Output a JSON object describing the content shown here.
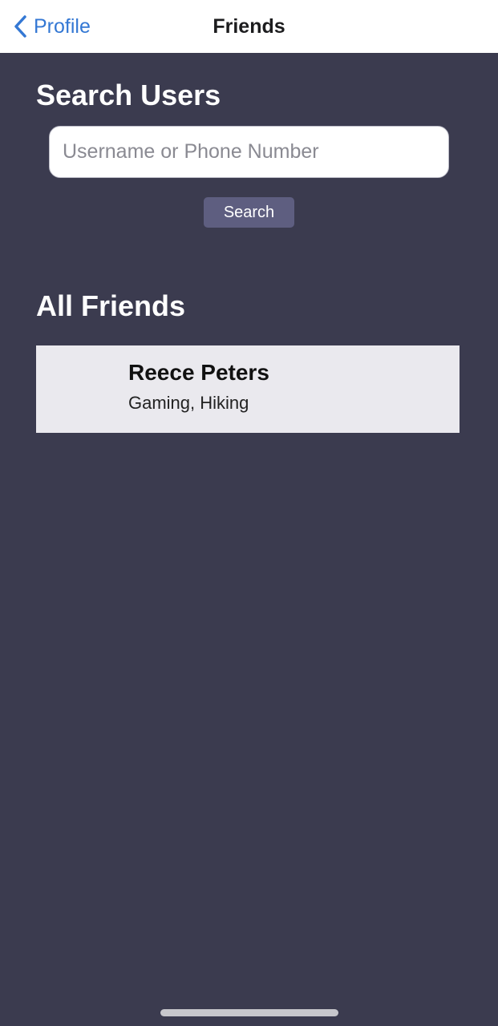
{
  "navbar": {
    "back_label": "Profile",
    "title": "Friends",
    "back_icon": "chevron-left-icon"
  },
  "search": {
    "heading": "Search Users",
    "placeholder": "Username or Phone Number",
    "value": "",
    "button_label": "Search"
  },
  "friends": {
    "heading": "All Friends",
    "items": [
      {
        "name": "Reece Peters",
        "interests": "Gaming, Hiking"
      }
    ]
  },
  "colors": {
    "background": "#3b3b4f",
    "navbar": "#ffffff",
    "link_blue": "#3478d4",
    "button": "#5e5e80",
    "card": "#eae9ee"
  }
}
